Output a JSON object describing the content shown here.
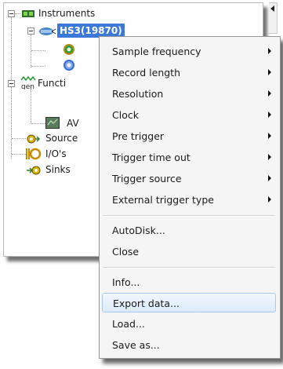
{
  "tree": {
    "instruments": "Instruments",
    "hs3": "HS3(19870)",
    "functions": "Functi",
    "functions_child": "AV",
    "sources": "Source",
    "ios": "I/O's",
    "sinks": "Sinks"
  },
  "context_menu": {
    "items": [
      {
        "label": "Sample frequency",
        "has_submenu": true
      },
      {
        "label": "Record length",
        "has_submenu": true
      },
      {
        "label": "Resolution",
        "has_submenu": true
      },
      {
        "label": "Clock",
        "has_submenu": true
      },
      {
        "label": "Pre trigger",
        "has_submenu": true
      },
      {
        "label": "Trigger time out",
        "has_submenu": true
      },
      {
        "label": "Trigger source",
        "has_submenu": true
      },
      {
        "label": "External trigger type",
        "has_submenu": true
      },
      {
        "label": "AutoDisk...",
        "has_submenu": false
      },
      {
        "label": "Close",
        "has_submenu": false
      },
      {
        "label": "Info...",
        "has_submenu": false
      },
      {
        "label": "Export data...",
        "has_submenu": false,
        "highlighted": true
      },
      {
        "label": "Load...",
        "has_submenu": false
      },
      {
        "label": "Save as...",
        "has_submenu": false
      }
    ]
  },
  "colors": {
    "selection": "#3b78d8",
    "menu_background": "#f5f5f5",
    "hover_border": "#a9c9ef"
  },
  "icons": {
    "instruments": "instruments-icon",
    "hs3": "oscilloscope-probe-icon",
    "channel": "channel-ring-icon",
    "functions": "gen-function-icon",
    "av": "av-block-icon",
    "sources": "source-icon",
    "ios": "io-icon",
    "sinks": "sink-icon"
  }
}
